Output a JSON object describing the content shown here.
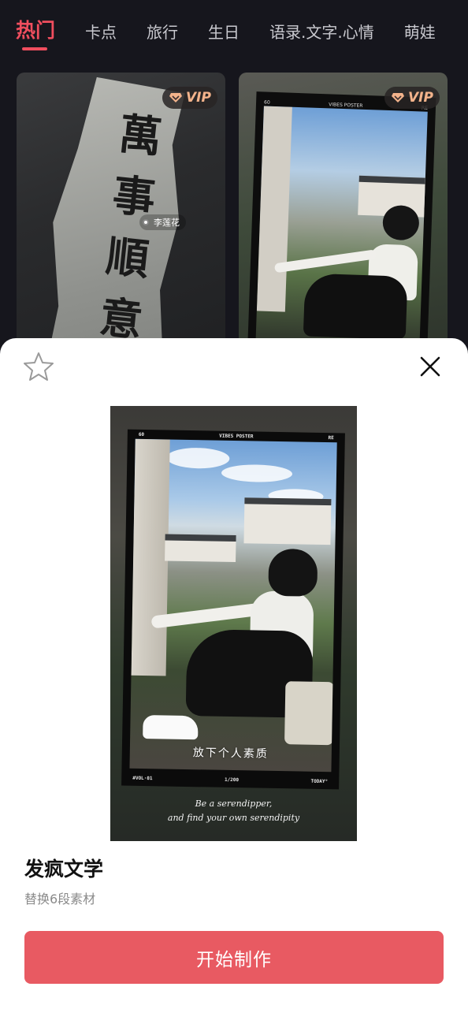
{
  "tabs": [
    {
      "label": "热门",
      "active": true
    },
    {
      "label": "卡点",
      "active": false
    },
    {
      "label": "旅行",
      "active": false
    },
    {
      "label": "生日",
      "active": false
    },
    {
      "label": "语录.文字.心情",
      "active": false
    },
    {
      "label": "萌娃",
      "active": false
    }
  ],
  "grid": {
    "cards": [
      {
        "badge": "VIP",
        "calligraphy": "萬事順意",
        "name_tag": "李莲花"
      },
      {
        "badge": "VIP",
        "frame_top_left": "60",
        "frame_top_center": "VIBES POSTER",
        "frame_top_right": "RE"
      }
    ]
  },
  "sheet": {
    "favorite_icon": "star-outline-icon",
    "close_icon": "close-icon",
    "preview": {
      "frame_top_left": "60",
      "frame_top_center": "VIBES POSTER",
      "frame_top_right": "RE",
      "overlay_text": "放下个人素质",
      "frame_bottom_left": "#VOL·01",
      "frame_bottom_center": "1/200",
      "frame_bottom_right": "TODAY°",
      "script_line_1": "Be a serendipper,",
      "script_line_2": "and find your own serendipity"
    },
    "title": "发疯文学",
    "subtitle": "替换6段素材",
    "cta_label": "开始制作"
  },
  "colors": {
    "accent": "#f04e5e",
    "cta": "#e85a62",
    "vip_text": "#f3b38b",
    "background": "#16161d"
  }
}
